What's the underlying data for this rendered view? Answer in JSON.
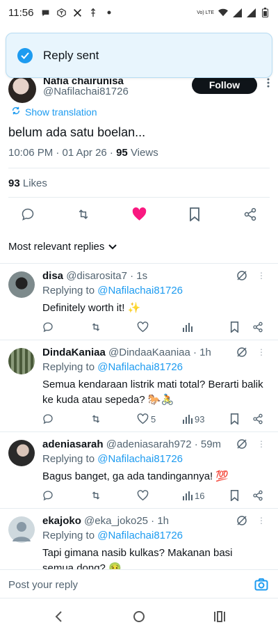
{
  "status_bar": {
    "time": "11:56",
    "network": "Vo) LTE",
    "right_icons": [
      "volte-icon",
      "wifi-icon",
      "signal-icon",
      "signal-icon-2",
      "battery-icon"
    ],
    "left_icons": [
      "chat-icon",
      "messenger-icon",
      "x-icon",
      "usb-icon",
      "dot-icon"
    ]
  },
  "toast": {
    "text": "Reply sent"
  },
  "tweet": {
    "author_name": "Nafia chairunisa",
    "author_handle": "@Nafilachai81726",
    "follow_label": "Follow",
    "translation_label": "Show translation",
    "text": "belum ada satu boelan...",
    "timestamp": "10:06 PM · 01 Apr 26 · ",
    "views_count": "95",
    "views_label": " Views",
    "likes_count": "93",
    "likes_label": " Likes"
  },
  "replies_filter": {
    "label": "Most relevant replies"
  },
  "replies": [
    {
      "name": "disa",
      "handle": "@disarosita7 · 1s",
      "replying_prefix": "Replying to ",
      "replying_to": "@Nafilachai81726",
      "text": "Definitely worth it! ✨",
      "likes": "",
      "views": ""
    },
    {
      "name": "DindaKaniaa",
      "handle": "@DindaaKaaniaa · 1h",
      "replying_prefix": "Replying to ",
      "replying_to": "@Nafilachai81726",
      "text": "Semua kendaraan listrik mati total? Berarti balik ke kuda atau sepeda? 🐎🚴",
      "likes": "5",
      "views": "93"
    },
    {
      "name": "adeniasarah",
      "handle": "@adeniasarah972 · 59m",
      "replying_prefix": "Replying to ",
      "replying_to": "@Nafilachai81726",
      "text": "Bagus banget, ga ada tandingannya! 💯",
      "likes": "",
      "views": "16"
    },
    {
      "name": "ekajoko",
      "handle": "@eka_joko25 · 1h",
      "replying_prefix": "Replying to ",
      "replying_to": "@Nafilachai81726",
      "text": "Tapi gimana nasib kulkas? Makanan basi semua dong? 🤢",
      "likes": "",
      "views": ""
    }
  ],
  "reply_bar": {
    "placeholder": "Post your reply"
  },
  "colors": {
    "accent": "#1d9bf0",
    "like": "#f91880",
    "text": "#0f1419",
    "muted": "#536471"
  }
}
